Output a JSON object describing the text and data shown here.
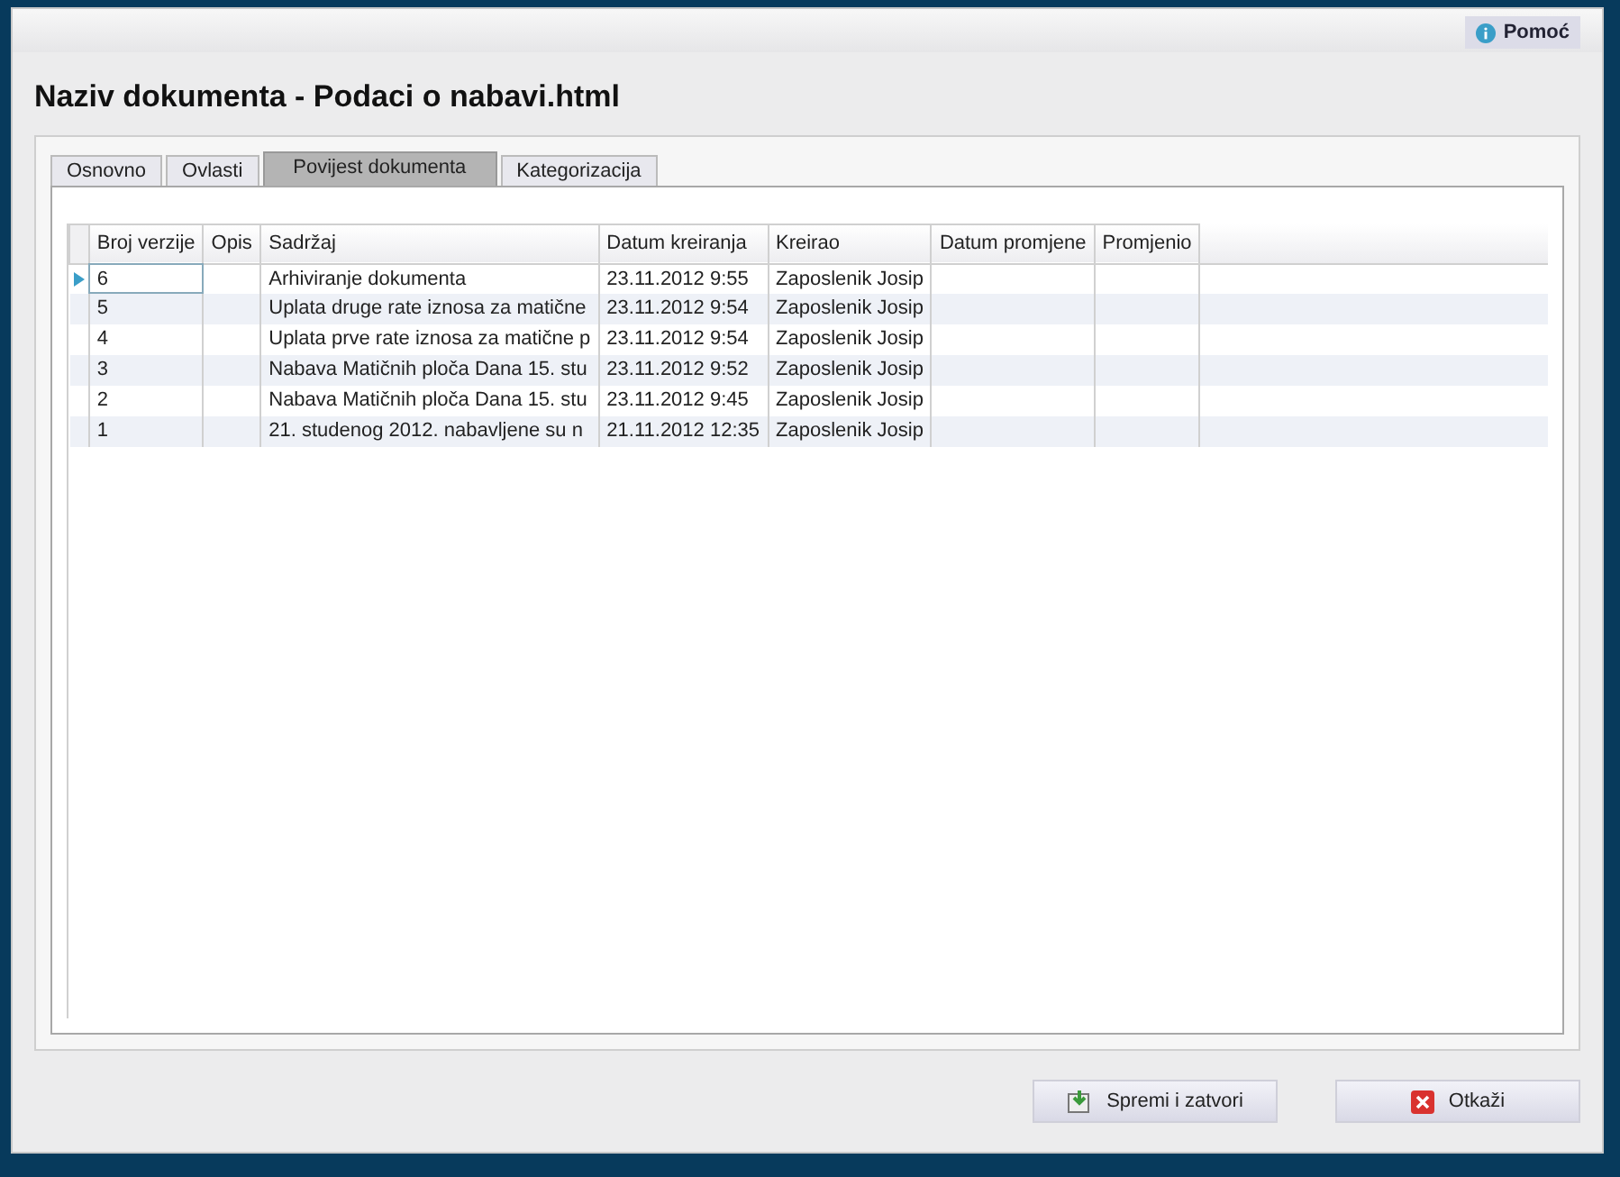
{
  "help_button": {
    "label": "Pomoć"
  },
  "window": {
    "title": "Naziv dokumenta - Podaci o nabavi.html"
  },
  "tabs": [
    {
      "label": "Osnovno",
      "selected": false
    },
    {
      "label": "Ovlasti",
      "selected": false
    },
    {
      "label": "Povijest dokumenta",
      "selected": true
    },
    {
      "label": "Kategorizacija",
      "selected": false
    }
  ],
  "table": {
    "columns": [
      "Broj verzije",
      "Opis",
      "Sadržaj",
      "Datum kreiranja",
      "Kreirao",
      "Datum promjene",
      "Promjenio"
    ],
    "rows": [
      {
        "selected": true,
        "cells": [
          "6",
          "",
          "Arhiviranje dokumenta",
          "23.11.2012 9:55",
          "Zaposlenik Josip",
          "",
          ""
        ]
      },
      {
        "selected": false,
        "cells": [
          "5",
          "",
          "Uplata druge rate iznosa za matične",
          "23.11.2012 9:54",
          "Zaposlenik Josip",
          "",
          ""
        ]
      },
      {
        "selected": false,
        "cells": [
          "4",
          "",
          "Uplata prve rate iznosa za matične p",
          "23.11.2012 9:54",
          "Zaposlenik Josip",
          "",
          ""
        ]
      },
      {
        "selected": false,
        "cells": [
          "3",
          "",
          "Nabava Matičnih ploča  Dana 15. stu",
          "23.11.2012 9:52",
          "Zaposlenik Josip",
          "",
          ""
        ]
      },
      {
        "selected": false,
        "cells": [
          "2",
          "",
          "Nabava Matičnih ploča Dana 15. stu",
          "23.11.2012 9:45",
          "Zaposlenik Josip",
          "",
          ""
        ]
      },
      {
        "selected": false,
        "cells": [
          "1",
          "",
          "21. studenog 2012. nabavljene su n",
          "21.11.2012 12:35",
          "Zaposlenik Josip",
          "",
          ""
        ]
      }
    ]
  },
  "buttons": [
    {
      "kind": "save",
      "label": "Spremi i zatvori"
    },
    {
      "kind": "cancel",
      "label": "Otkaži"
    }
  ]
}
